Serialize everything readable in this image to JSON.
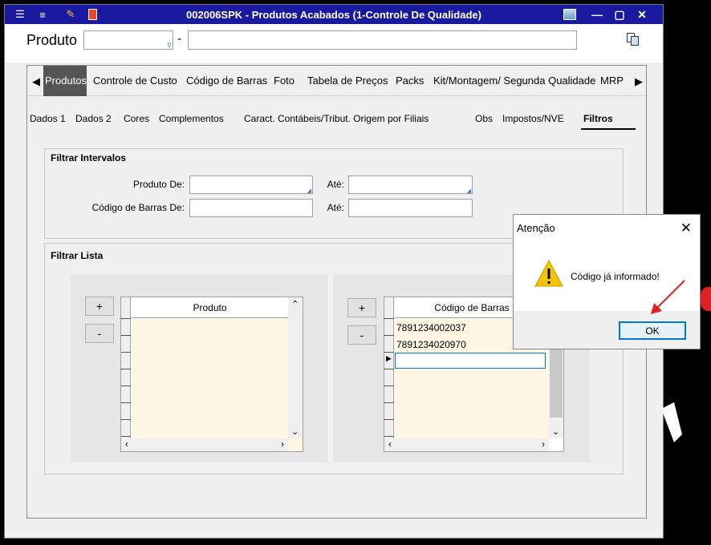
{
  "window": {
    "title": "002006SPK - Produtos Acabados (1-Controle De Qualidade)",
    "minimize": "—",
    "maximize": "▢",
    "close": "✕"
  },
  "header": {
    "produto_label": "Produto",
    "separator": "-"
  },
  "tabs": [
    "Produtos",
    "Controle de Custo",
    "Código de Barras",
    "Foto",
    "Tabela de Preços",
    "Packs",
    "Kit/Montagem/ Segunda Qualidade",
    "MRP"
  ],
  "subtabs": [
    "Dados 1",
    "Dados 2",
    "Cores",
    "Complementos",
    "Caract. Contábeis/Tribut. Origem por Filiais",
    "Obs",
    "Impostos/NVE",
    "Filtros"
  ],
  "filtrar_intervalos": {
    "title": "Filtrar Intervalos",
    "produto_de": "Produto De:",
    "ate1": "Até:",
    "codigo_barras_de": "Código de Barras De:",
    "ate2": "Até:"
  },
  "filtrar_lista": {
    "title": "Filtrar Lista",
    "add": "+",
    "remove": "-",
    "produto_header": "Produto",
    "codigo_header": "Código de Barras",
    "codigos": [
      "7891234002037",
      "7891234020970"
    ]
  },
  "dialog": {
    "title": "Atenção",
    "close": "✕",
    "message": "Código já informado!",
    "ok": "OK"
  },
  "colors": {
    "titlebar": "#1a1aa0",
    "grid_body": "#fdf6e3",
    "ok_border": "#0078d7",
    "annotation": "#e02020"
  }
}
